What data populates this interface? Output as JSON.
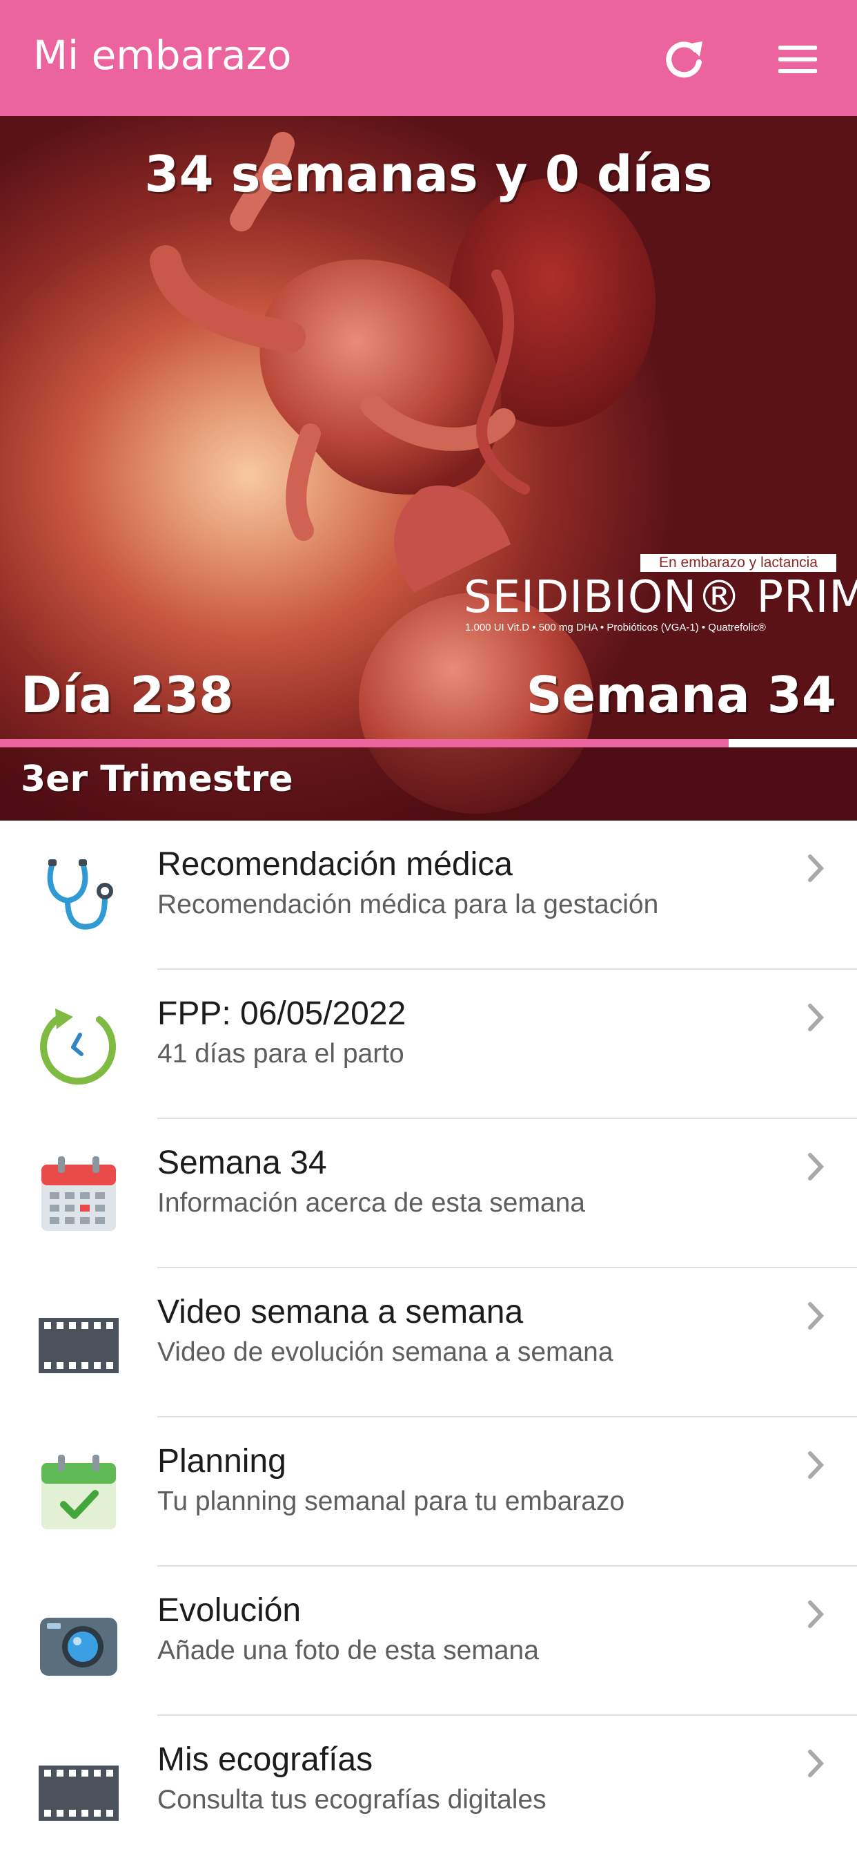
{
  "header": {
    "title": "Mi embarazo"
  },
  "hero": {
    "title": "34 semanas y 0 días",
    "day": "Día 238",
    "week": "Semana 34",
    "trimester": "3er Trimestre",
    "progress_fraction": 0.85,
    "brand": {
      "tag": "En embarazo y lactancia",
      "name": "SEIDIBION® PRIME",
      "sub": "1.000 UI Vit.D • 500 mg DHA • Probióticos (VGA-1) • Quatrefolic®"
    }
  },
  "list": [
    {
      "icon": "stethoscope-icon",
      "title": "Recomendación médica",
      "subtitle": "Recomendación médica para la gestación"
    },
    {
      "icon": "clock-icon",
      "title": "FPP: 06/05/2022",
      "subtitle": "41 días para el parto"
    },
    {
      "icon": "calendar-icon",
      "title": "Semana 34",
      "subtitle": "Información acerca de esta semana"
    },
    {
      "icon": "film-icon",
      "title": "Video semana a semana",
      "subtitle": "Video de evolución semana a semana"
    },
    {
      "icon": "calendar-check-icon",
      "title": "Planning",
      "subtitle": "Tu planning semanal para tu embarazo"
    },
    {
      "icon": "camera-icon",
      "title": "Evolución",
      "subtitle": "Añade una foto de esta semana"
    },
    {
      "icon": "film-icon",
      "title": "Mis ecografías",
      "subtitle": "Consulta tus ecografías digitales"
    }
  ],
  "colors": {
    "accent": "#ec649d"
  }
}
